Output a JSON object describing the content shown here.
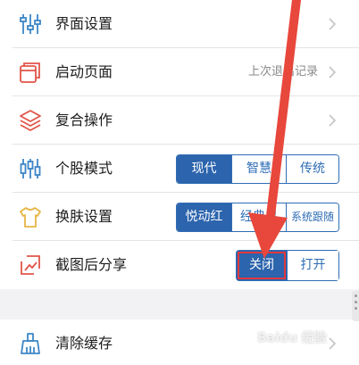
{
  "colors": {
    "accent": "#2c64ad",
    "icon_blue": "#3d86c6",
    "icon_red": "#e1554a",
    "icon_yellow": "#e6b445",
    "arrow": "#e8473c"
  },
  "settings": [
    {
      "label": "界面设置",
      "icon": "sliders-icon",
      "trailing": "chevron"
    },
    {
      "label": "启动页面",
      "icon": "pages-icon",
      "value": "上次退出记录",
      "trailing": "chevron"
    },
    {
      "label": "复合操作",
      "icon": "layers-icon",
      "trailing": "chevron"
    },
    {
      "label": "个股模式",
      "icon": "candlestick-icon",
      "options": [
        "现代",
        "智慧",
        "传统"
      ],
      "selected": 0
    },
    {
      "label": "换肤设置",
      "icon": "tshirt-icon",
      "options": [
        "悦动红",
        "经典黑",
        "系统跟随"
      ],
      "selected": 0
    },
    {
      "label": "截图后分享",
      "icon": "screenshot-icon",
      "options": [
        "关闭",
        "打开"
      ],
      "selected": 0
    },
    {
      "label": "清除缓存",
      "icon": "broom-icon",
      "trailing": "chevron"
    }
  ],
  "watermark": "Baidu 经验"
}
